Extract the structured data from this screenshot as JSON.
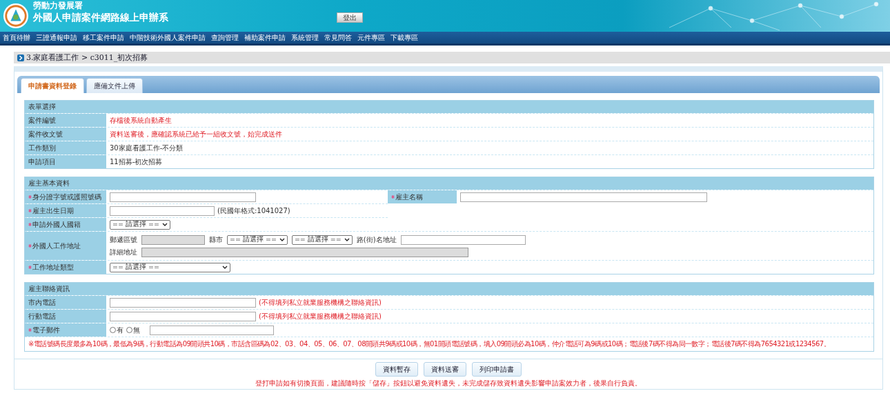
{
  "header": {
    "agency": "勞動力發展署",
    "system_title": "外國人申請案件網路線上申辦系",
    "logout_button": "登出"
  },
  "nav": [
    "首頁待辦",
    "三證通報申請",
    "移工案件申請",
    "中階技術外國人案件申請",
    "查詢管理",
    "補助案件申請",
    "系統管理",
    "常見問答",
    "元件專區",
    "下載專區"
  ],
  "breadcrumb": "3.家庭看護工作 > c3011_初次招募",
  "tabs": [
    {
      "label": "申請書資料登錄",
      "selected": true
    },
    {
      "label": "應備文件上傳",
      "selected": false
    }
  ],
  "form_selection": {
    "title": "表單選擇",
    "rows": [
      {
        "label": "案件編號",
        "value": "存檔後系統自動產生",
        "notice": true
      },
      {
        "label": "案件收文號",
        "value": "資料送審後，應確認系統已給予一組收文號，始完成送件",
        "notice": true
      },
      {
        "label": "工作類別",
        "value": "30家庭看護工作-不分類",
        "notice": false
      },
      {
        "label": "申請項目",
        "value": "11招募-初次招募",
        "notice": false
      }
    ]
  },
  "employer_basic": {
    "title": "雇主基本資料",
    "id_number": {
      "label": "身分證字號或護照號碼",
      "required": true
    },
    "employer_name": {
      "label": "雇主名稱",
      "required": true
    },
    "birth_date": {
      "label": "雇主出生日期",
      "required": true,
      "hint": "(民國年格式:1041027)"
    },
    "nationality": {
      "label": "申請外國人國籍",
      "required": true,
      "select": "== 請選擇 =="
    },
    "work_address": {
      "label": "外國人工作地址",
      "required": true,
      "postal_label": "郵遞區號",
      "postal_disabled": true,
      "city_label": "縣市",
      "city_select": "== 請選擇 ==",
      "district_select": "== 請選擇 ==",
      "street_label": "路(街)名地址",
      "detail_label": "詳細地址",
      "detail_disabled": true
    },
    "address_type": {
      "label": "工作地址類型",
      "required": true,
      "select": "== 請選擇 =="
    }
  },
  "employer_contact": {
    "title": "雇主聯絡資訊",
    "rows": [
      {
        "kind": "text",
        "label": "市內電話",
        "required": false,
        "hint": "(不得填列私立就業服務機構之聯絡資訊)"
      },
      {
        "kind": "text",
        "label": "行動電話",
        "required": false,
        "hint": "(不得填列私立就業服務機構之聯絡資訊)"
      },
      {
        "kind": "radio_text",
        "label": "電子郵件",
        "required": true,
        "options": [
          {
            "label": "有",
            "selected": false
          },
          {
            "label": "無",
            "selected": false
          }
        ]
      }
    ],
    "note": "※電話號碼長度最多為10碼，最低為9碼，行動電話為09開頭共10碼，市話含區碼為02、03、04、05、06、07、08開頭共9碼或10碼，無01開頭電話號碼，填入09開頭必為10碼，仲介電話可為9碼或10碼；電話後7碼不得為同一數字；電話後7碼不得為7654321或1234567。"
  },
  "actions": [
    "資料暫存",
    "資料送審",
    "列印申請書"
  ],
  "warning": "登打申請如有切換頁面，建議隨時按「儲存」按鈕以避免資料遺失，未完成儲存致資料遺失影響申請案效力者，後果自行負責。"
}
